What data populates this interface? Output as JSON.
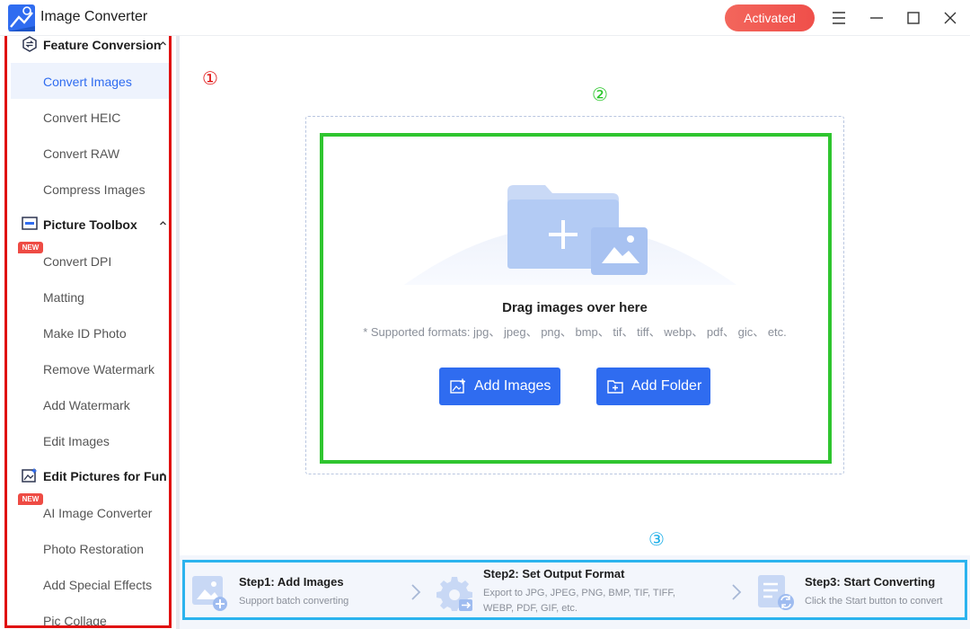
{
  "app": {
    "title": "Image Converter",
    "activated_label": "Activated"
  },
  "window_controls": [
    "menu-icon",
    "minimize-icon",
    "maximize-icon",
    "close-icon"
  ],
  "sidebar": {
    "groups": [
      {
        "label": "Feature Conversion",
        "icon": "convert-icon",
        "items": [
          {
            "label": "Convert Images",
            "active": true
          },
          {
            "label": "Convert HEIC"
          },
          {
            "label": "Convert RAW"
          },
          {
            "label": "Compress Images"
          }
        ]
      },
      {
        "label": "Picture Toolbox",
        "icon": "toolbox-icon",
        "items": [
          {
            "label": "Convert DPI",
            "badge": "NEW"
          },
          {
            "label": "Matting"
          },
          {
            "label": "Make ID Photo"
          },
          {
            "label": "Remove Watermark"
          },
          {
            "label": "Add Watermark"
          },
          {
            "label": "Edit Images"
          }
        ]
      },
      {
        "label": "Edit Pictures for Fun",
        "icon": "fun-edit-icon",
        "items": [
          {
            "label": "AI Image Converter",
            "badge": "NEW"
          },
          {
            "label": "Photo Restoration"
          },
          {
            "label": "Add Special Effects"
          },
          {
            "label": "Pic Collage"
          }
        ]
      }
    ]
  },
  "annotations": {
    "one": "①",
    "two": "②",
    "three": "③"
  },
  "dropzone": {
    "title": "Drag images over here",
    "formats": "* Supported formats: jpg、 jpeg、 png、 bmp、 tif、 tiff、 webp、 pdf、 gic、 etc.",
    "add_images_label": "Add Images",
    "add_folder_label": "Add Folder"
  },
  "steps": [
    {
      "title": "Step1:  Add Images",
      "desc": "Support batch converting"
    },
    {
      "title": "Step2:  Set Output Format",
      "desc": "Export to JPG, JPEG, PNG, BMP, TIF, TIFF, WEBP, PDF, GIF, etc."
    },
    {
      "title": "Step3:  Start Converting",
      "desc": "Click the Start button to convert"
    }
  ],
  "colors": {
    "accent": "#2f6cf0",
    "activated": "#ef5350",
    "annotation_red": "#e01010",
    "annotation_green": "#22c422",
    "annotation_blue": "#1aaee8"
  }
}
